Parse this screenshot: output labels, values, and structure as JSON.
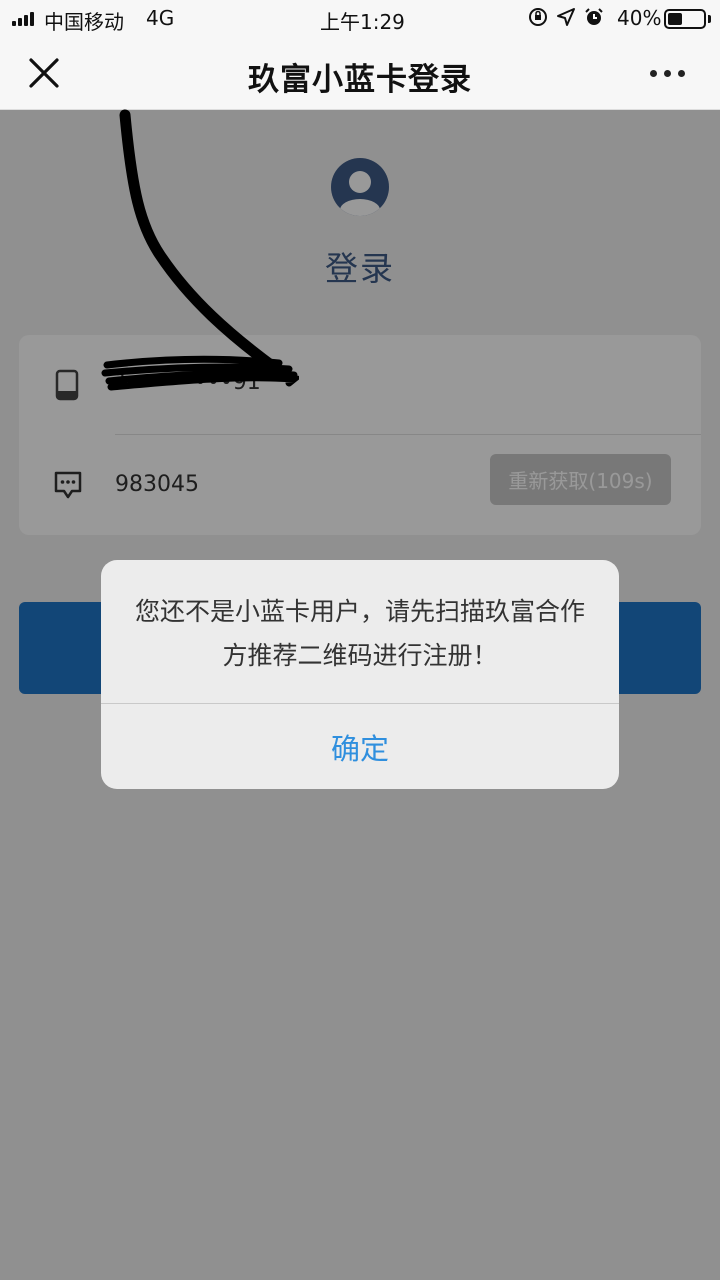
{
  "status_bar": {
    "carrier": "中国移动",
    "network": "4G",
    "time": "上午1:29",
    "battery_percent": "40%",
    "battery_level": 0.4,
    "icons": [
      "orientation-lock-icon",
      "location-icon",
      "alarm-icon"
    ]
  },
  "nav": {
    "title": "玖富小蓝卡登录",
    "close_icon": "close-icon",
    "more_icon": "more-icon"
  },
  "login": {
    "heading": "登录",
    "phone_value": "1••••••••91",
    "code_value": "983045",
    "resend_label": "重新获取(109s)",
    "login_button_label": ""
  },
  "dialog": {
    "message": "您还不是小蓝卡用户，请先扫描玖富合作方推荐二维码进行注册！",
    "confirm_label": "确定"
  },
  "colors": {
    "accent": "#1f75c7",
    "link": "#2f8fde",
    "heading": "#3f5b86"
  }
}
